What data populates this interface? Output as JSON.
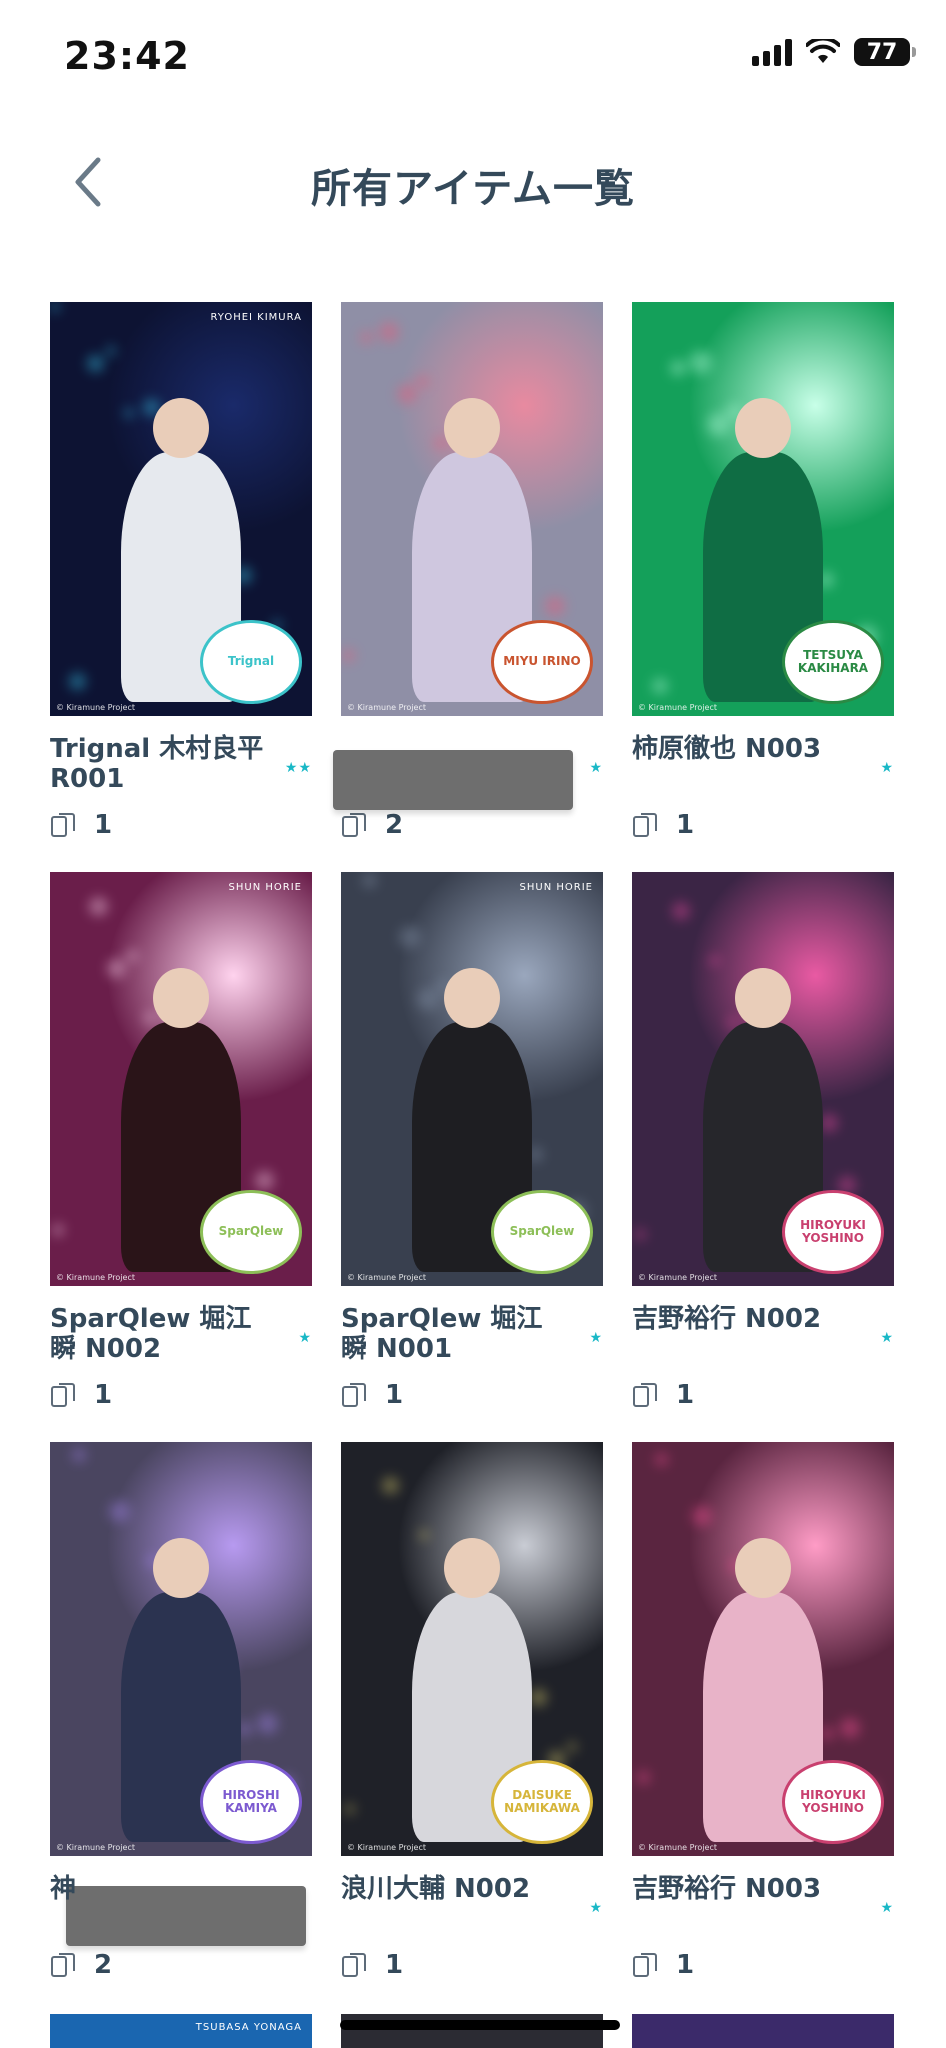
{
  "status": {
    "time": "23:42",
    "battery": "77"
  },
  "header": {
    "title": "所有アイテム一覧"
  },
  "items": [
    {
      "title": "Trignal 木村良平 R001",
      "stars": "★★",
      "count": "1",
      "bg": "#0d1333",
      "accent": "#38c6e8",
      "badge": "Trignal",
      "badgeColor": "#3cc3c9",
      "corner": "RYOHEI KIMURA",
      "light": "#1a2a6a",
      "fig": "#e6e9ee"
    },
    {
      "title": "",
      "stars": "★",
      "count": "2",
      "bg": "#8f8fa6",
      "accent": "#e85b7a",
      "badge": "MIYU IRINO",
      "badgeColor": "#c9542f",
      "corner": "",
      "light": "#e88aa0",
      "fig": "#cfc7df"
    },
    {
      "title": "柿原徹也 N003",
      "stars": "★",
      "count": "1",
      "bg": "#14a05a",
      "accent": "#a7f5d2",
      "badge": "TETSUYA KAKIHARA",
      "badgeColor": "#2a8a44",
      "corner": "",
      "light": "#c8ffe8",
      "fig": "#0f6d44"
    },
    {
      "title": "SparQlew 堀江瞬 N002",
      "stars": "★",
      "count": "1",
      "bg": "#6a1e4a",
      "accent": "#f3c7e3",
      "badge": "SparQlew",
      "badgeColor": "#8dbf58",
      "corner": "SHUN HORIE",
      "light": "#ffd3ee",
      "fig": "#2a1418"
    },
    {
      "title": "SparQlew 堀江瞬 N001",
      "stars": "★",
      "count": "1",
      "bg": "#39404f",
      "accent": "#7d8aa0",
      "badge": "SparQlew",
      "badgeColor": "#8dbf58",
      "corner": "SHUN HORIE",
      "light": "#9aa7bd",
      "fig": "#1e1e22"
    },
    {
      "title": "吉野裕行 N002",
      "stars": "★",
      "count": "1",
      "bg": "#3b2545",
      "accent": "#e0479a",
      "badge": "HIROYUKI YOSHINO",
      "badgeColor": "#c9406f",
      "corner": "",
      "light": "#e95aa3",
      "fig": "#26262b"
    },
    {
      "title": "",
      "stars": "",
      "count": "2",
      "bg": "#4a4560",
      "accent": "#9b7fe0",
      "badge": "HIROSHI KAMIYA",
      "badgeColor": "#7c5ad0",
      "corner": "",
      "light": "#b79af0",
      "fig": "#2b3350"
    },
    {
      "title": "浪川大輔 N002",
      "stars": "★",
      "count": "1",
      "bg": "#1f2128",
      "accent": "#d6c96b",
      "badge": "DAISUKE NAMIKAWA",
      "badgeColor": "#d6b53a",
      "corner": "",
      "light": "#c9ccd4",
      "fig": "#d7d7dc"
    },
    {
      "title": "吉野裕行 N003",
      "stars": "★",
      "count": "1",
      "bg": "#5a2540",
      "accent": "#ef4d90",
      "badge": "HIROYUKI YOSHINO",
      "badgeColor": "#c9406f",
      "corner": "",
      "light": "#ff9cc6",
      "fig": "#e8b3c8"
    }
  ],
  "peek": [
    {
      "bg": "#1a66b0",
      "corner": "TSUBASA YONAGA"
    },
    {
      "bg": "#2b2b33",
      "corner": ""
    },
    {
      "bg": "#3b2a6a",
      "corner": ""
    }
  ],
  "copyright": "© Kiramune Project"
}
